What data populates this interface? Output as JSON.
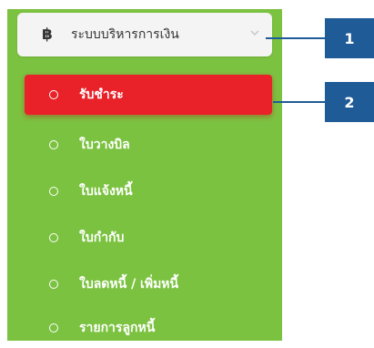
{
  "header": {
    "icon": "baht-icon",
    "icon_glyph": "฿",
    "label": "ระบบบริหารการเงิน",
    "chevron": "chevron-down-icon"
  },
  "menu": {
    "items": [
      {
        "label": "รับชำระ",
        "active": true
      },
      {
        "label": "ใบวางบิล",
        "active": false
      },
      {
        "label": "ใบแจ้งหนี้",
        "active": false
      },
      {
        "label": "ใบกำกับ",
        "active": false
      },
      {
        "label": "ใบลดหนี้ / เพิ่มหนี้",
        "active": false
      },
      {
        "label": "รายการลูกหนี้",
        "active": false
      }
    ]
  },
  "callouts": [
    {
      "number": "1"
    },
    {
      "number": "2"
    }
  ],
  "colors": {
    "sidebar_bg": "#7cc241",
    "active_bg": "#e9222a",
    "header_bg": "#f4f4f4",
    "callout": "#1f5b97"
  }
}
